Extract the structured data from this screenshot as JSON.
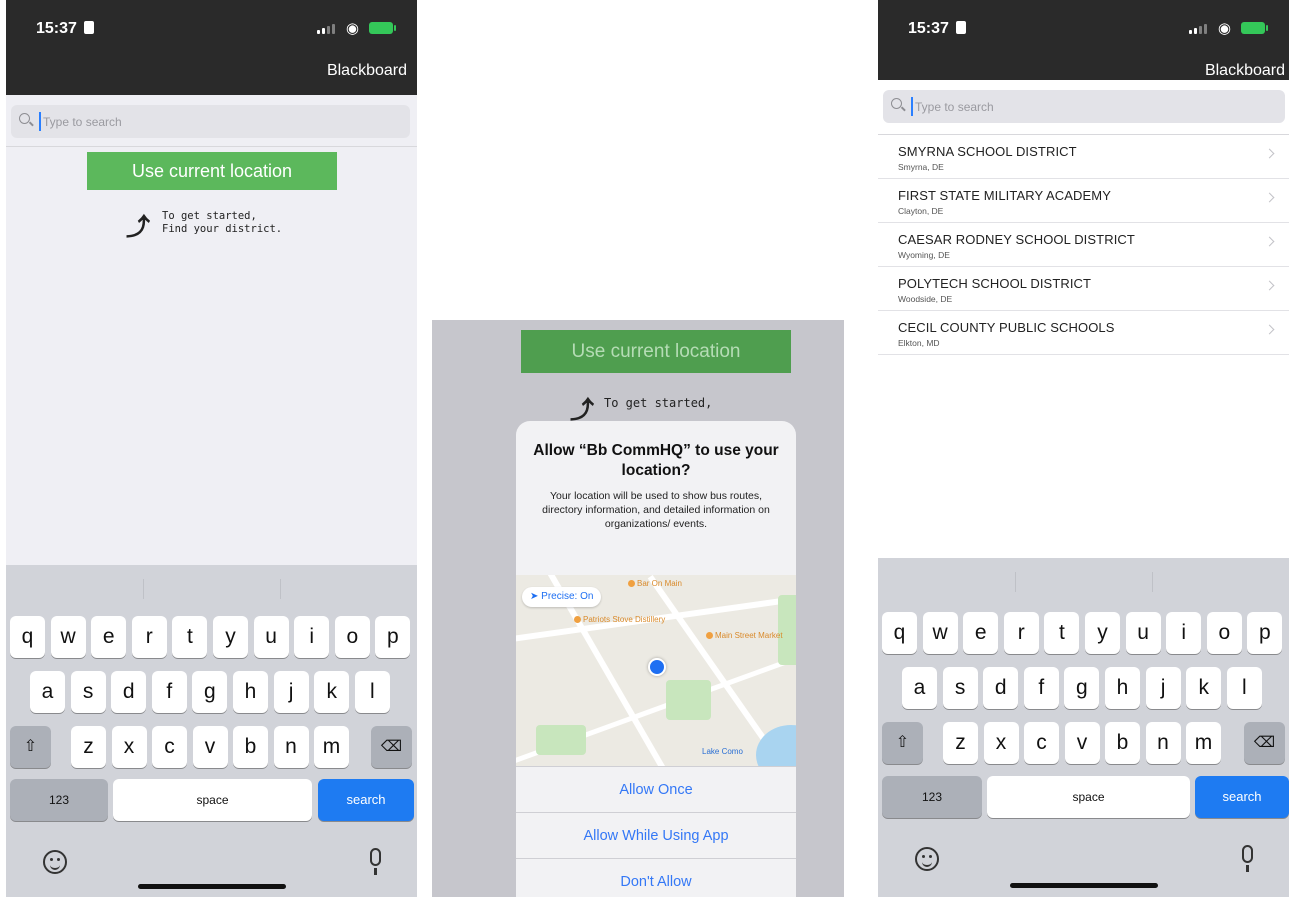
{
  "status": {
    "time": "15:37"
  },
  "header": {
    "brand": "Blackboard"
  },
  "search": {
    "placeholder": "Type to search"
  },
  "location_button": "Use current location",
  "hint": {
    "line1": "To get started,",
    "line2": "Find your district."
  },
  "hint_partial": "To get started,",
  "permission_dialog": {
    "title": "Allow “Bb CommHQ” to use your location?",
    "message": "Your location will be used to show bus routes, directory information, and detailed information on organizations/ events.",
    "precise_label": "Precise: On",
    "map_labels": [
      "Bar On Main",
      "Patriots Stove Distillery",
      "Main Street Market",
      "Lake Como"
    ],
    "actions": [
      "Allow Once",
      "Allow While Using App",
      "Don't Allow"
    ]
  },
  "districts": [
    {
      "name": "SMYRNA SCHOOL DISTRICT",
      "place": "Smyrna, DE"
    },
    {
      "name": "FIRST STATE MILITARY ACADEMY",
      "place": "Clayton, DE"
    },
    {
      "name": "CAESAR RODNEY SCHOOL DISTRICT",
      "place": "Wyoming, DE"
    },
    {
      "name": "POLYTECH SCHOOL DISTRICT",
      "place": "Woodside, DE"
    },
    {
      "name": "CECIL COUNTY PUBLIC SCHOOLS",
      "place": "Elkton, MD"
    }
  ],
  "keyboard": {
    "row1": [
      "q",
      "w",
      "e",
      "r",
      "t",
      "y",
      "u",
      "i",
      "o",
      "p"
    ],
    "row2": [
      "a",
      "s",
      "d",
      "f",
      "g",
      "h",
      "j",
      "k",
      "l"
    ],
    "row3": [
      "z",
      "x",
      "c",
      "v",
      "b",
      "n",
      "m"
    ],
    "numbers_key": "123",
    "space_key": "space",
    "search_key": "search"
  },
  "colors": {
    "accent_green": "#5cb85c",
    "ios_blue": "#3478f6",
    "header_dark": "#2a2a2a"
  }
}
